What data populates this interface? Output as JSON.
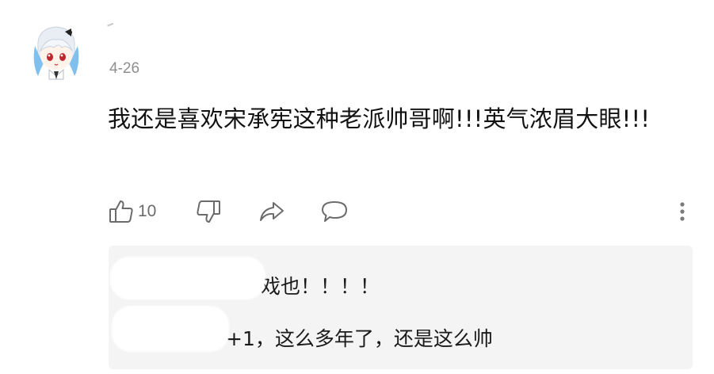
{
  "comment": {
    "date": "4-26",
    "text": "我还是喜欢宋承宪这种老派帅哥啊!!!英气浓眉大眼!!!",
    "like_count": "10"
  },
  "replies": [
    {
      "author": "",
      "text": "戏也！！！！"
    },
    {
      "author": "",
      "text": "+1，这么多年了，还是这么帅"
    }
  ],
  "icons": {
    "like": "thumbs-up-icon",
    "dislike": "thumbs-down-icon",
    "share": "share-arrow-icon",
    "reply": "speech-bubble-icon",
    "more": "vertical-ellipsis-icon"
  },
  "colors": {
    "text": "#121212",
    "muted": "#8e8e8e",
    "icon": "#6b6b6b",
    "reply_bg": "#f4f4f4",
    "link": "#2a6db0"
  }
}
